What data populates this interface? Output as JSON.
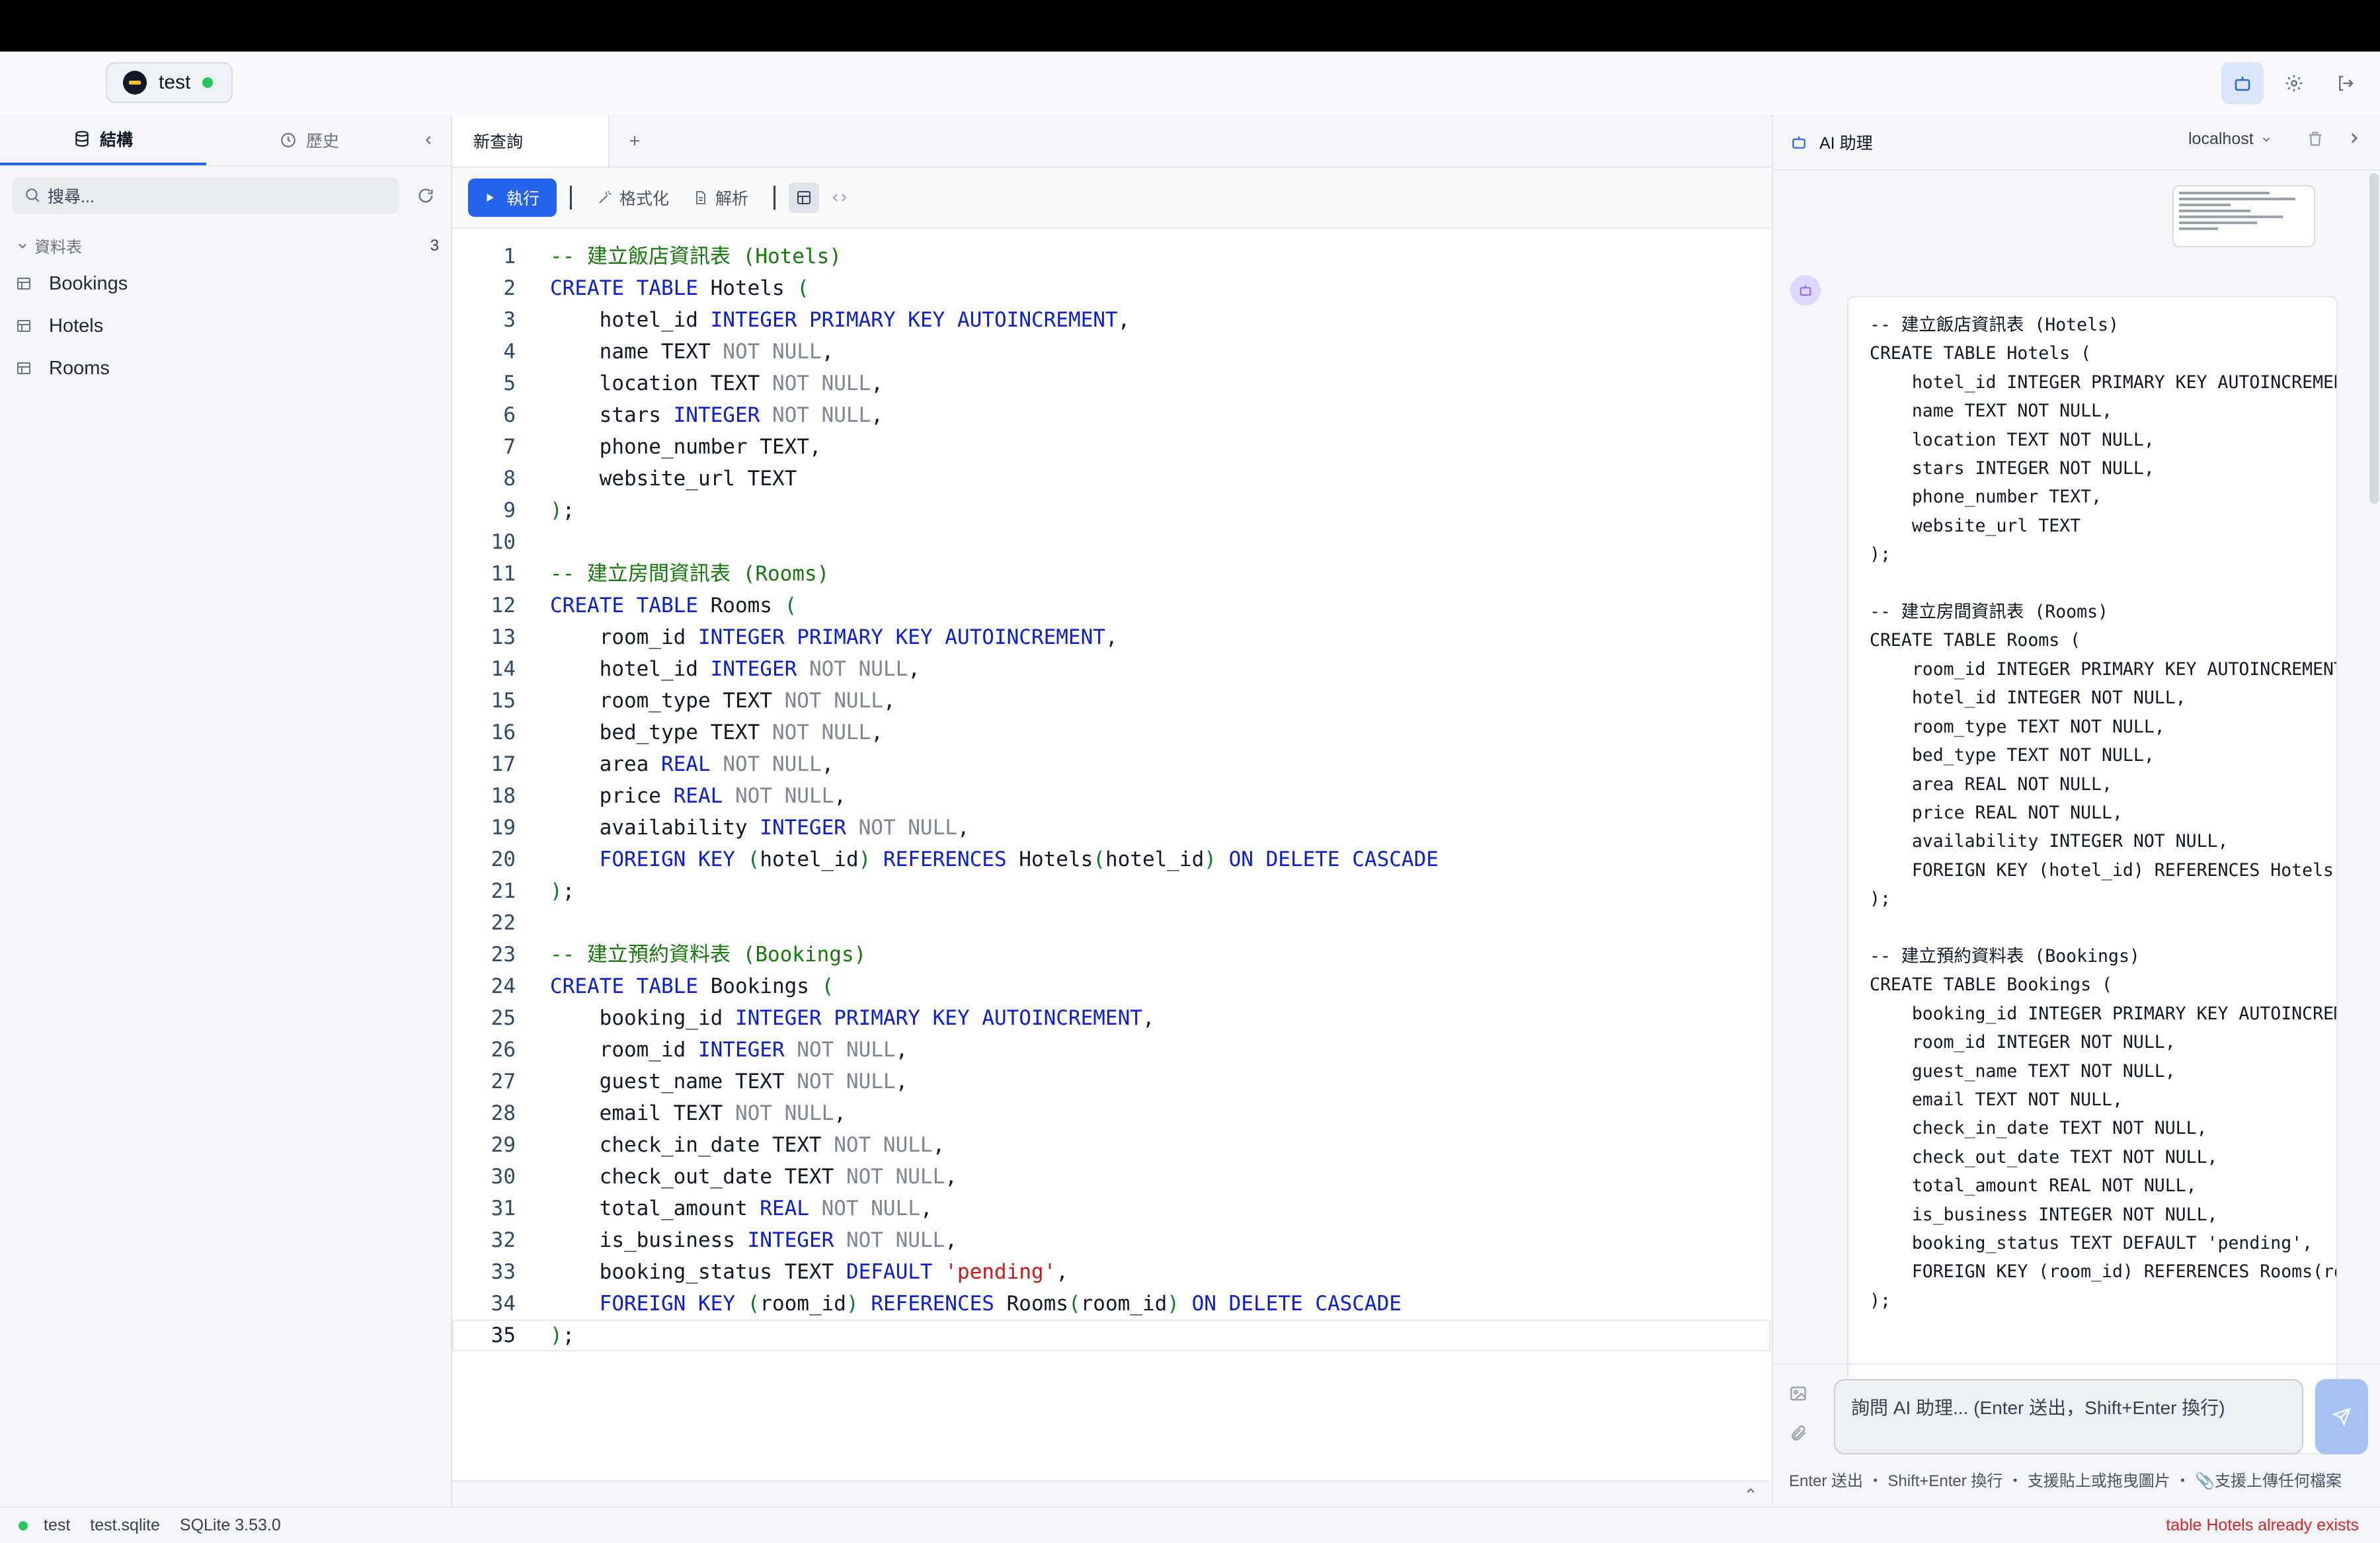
{
  "header": {
    "connection_name": "test"
  },
  "sidebar": {
    "tabs": [
      {
        "label": "結構"
      },
      {
        "label": "歷史"
      }
    ],
    "search_placeholder": "搜尋...",
    "section_label": "資料表",
    "section_count": "3",
    "items": [
      {
        "label": "Bookings"
      },
      {
        "label": "Hotels"
      },
      {
        "label": "Rooms"
      }
    ]
  },
  "editor": {
    "tab_label": "新查詢",
    "toolbar": {
      "run": "執行",
      "format": "格式化",
      "explain": "解析"
    },
    "code_lines": [
      "-- 建立飯店資訊表 (Hotels)",
      "CREATE TABLE Hotels (",
      "    hotel_id INTEGER PRIMARY KEY AUTOINCREMENT,",
      "    name TEXT NOT NULL,",
      "    location TEXT NOT NULL,",
      "    stars INTEGER NOT NULL,",
      "    phone_number TEXT,",
      "    website_url TEXT",
      ");",
      "",
      "-- 建立房間資訊表 (Rooms)",
      "CREATE TABLE Rooms (",
      "    room_id INTEGER PRIMARY KEY AUTOINCREMENT,",
      "    hotel_id INTEGER NOT NULL,",
      "    room_type TEXT NOT NULL,",
      "    bed_type TEXT NOT NULL,",
      "    area REAL NOT NULL,",
      "    price REAL NOT NULL,",
      "    availability INTEGER NOT NULL,",
      "    FOREIGN KEY (hotel_id) REFERENCES Hotels(hotel_id) ON DELETE CASCADE",
      ");",
      "",
      "-- 建立預約資料表 (Bookings)",
      "CREATE TABLE Bookings (",
      "    booking_id INTEGER PRIMARY KEY AUTOINCREMENT,",
      "    room_id INTEGER NOT NULL,",
      "    guest_name TEXT NOT NULL,",
      "    email TEXT NOT NULL,",
      "    check_in_date TEXT NOT NULL,",
      "    check_out_date TEXT NOT NULL,",
      "    total_amount REAL NOT NULL,",
      "    is_business INTEGER NOT NULL,",
      "    booking_status TEXT DEFAULT 'pending',",
      "    FOREIGN KEY (room_id) REFERENCES Rooms(room_id) ON DELETE CASCADE",
      ");"
    ],
    "current_line": 35
  },
  "ai_panel": {
    "title": "AI 助理",
    "host": "localhost",
    "message_text": "-- 建立飯店資訊表 (Hotels)\nCREATE TABLE Hotels (\n    hotel_id INTEGER PRIMARY KEY AUTOINCREMENT,\n    name TEXT NOT NULL,\n    location TEXT NOT NULL,\n    stars INTEGER NOT NULL,\n    phone_number TEXT,\n    website_url TEXT\n);\n\n-- 建立房間資訊表 (Rooms)\nCREATE TABLE Rooms (\n    room_id INTEGER PRIMARY KEY AUTOINCREMENT,\n    hotel_id INTEGER NOT NULL,\n    room_type TEXT NOT NULL,\n    bed_type TEXT NOT NULL,\n    area REAL NOT NULL,\n    price REAL NOT NULL,\n    availability INTEGER NOT NULL,\n    FOREIGN KEY (hotel_id) REFERENCES Hotels(hotel_id) ON DELETE CASCADE\n);\n\n-- 建立預約資料表 (Bookings)\nCREATE TABLE Bookings (\n    booking_id INTEGER PRIMARY KEY AUTOINCREMENT,\n    room_id INTEGER NOT NULL,\n    guest_name TEXT NOT NULL,\n    email TEXT NOT NULL,\n    check_in_date TEXT NOT NULL,\n    check_out_date TEXT NOT NULL,\n    total_amount REAL NOT NULL,\n    is_business INTEGER NOT NULL,\n    booking_status TEXT DEFAULT 'pending',\n    FOREIGN KEY (room_id) REFERENCES Rooms(room_id) ON DELETE CASCADE\n);",
    "input_placeholder": "詢問 AI 助理... (Enter 送出，Shift+Enter 換行)",
    "hint": "Enter 送出 ・ Shift+Enter 換行 ・ 支援貼上或拖曳圖片 ・ 📎支援上傳任何檔案"
  },
  "status": {
    "connection": "test",
    "file": "test.sqlite",
    "engine": "SQLite 3.53.0",
    "error": "table Hotels already exists"
  },
  "colors": {
    "accent": "#2563eb",
    "keyword": "#0a1ed6",
    "comment": "#16790b",
    "string": "#d41515",
    "muted_keyword": "#7d8794",
    "error": "#dc2626",
    "online": "#22c55e"
  },
  "icons": [
    "database-icon",
    "clock-icon",
    "chevron-left-icon",
    "search-icon",
    "refresh-icon",
    "chevron-down-icon",
    "table-icon",
    "plus-icon",
    "play-icon",
    "wand-icon",
    "file-icon",
    "grid-icon",
    "code-icon",
    "bot-icon",
    "gear-icon",
    "logout-icon",
    "trash-icon",
    "chevron-right-icon",
    "image-icon",
    "paperclip-icon",
    "send-icon"
  ]
}
